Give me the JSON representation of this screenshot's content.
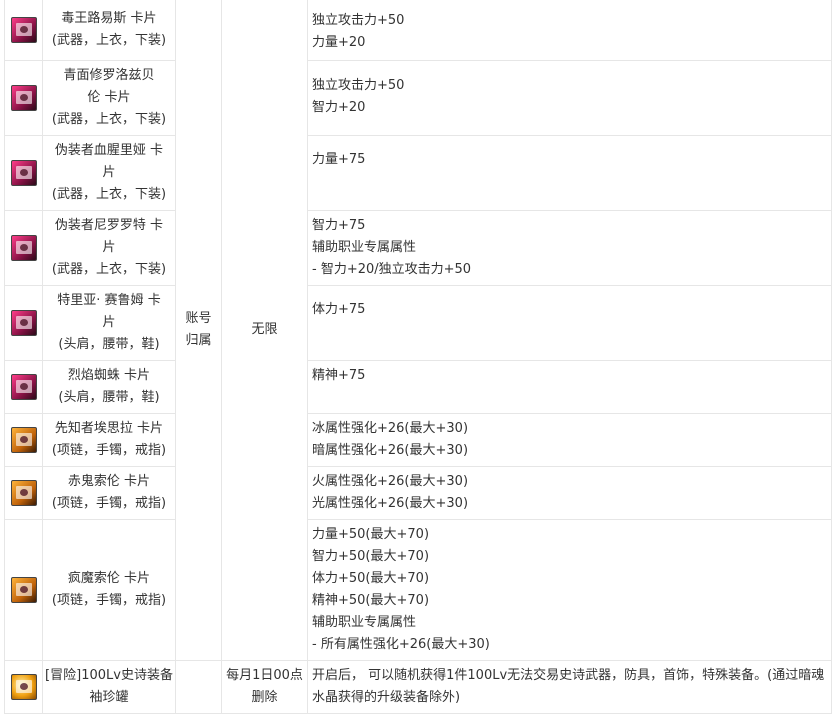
{
  "account_attr": [
    "账号",
    "归属"
  ],
  "limit_unlimited": "无限",
  "rows": [
    {
      "icon": "pink-card-icon",
      "name": [
        "毒王路易斯  卡片",
        "(武器，上衣，下装)"
      ],
      "effects": [
        "独立攻击力+50",
        "力量+20"
      ]
    },
    {
      "icon": "pink-card-icon",
      "name": [
        "青面修罗洛兹贝",
        "伦  卡片",
        "(武器，上衣，下装)"
      ],
      "effects": [
        "独立攻击力+50",
        "智力+20"
      ]
    },
    {
      "icon": "pink-card-icon",
      "name": [
        "伪装者血腥里娅  卡",
        "片",
        "(武器，上衣，下装)"
      ],
      "effects": [
        "力量+75"
      ]
    },
    {
      "icon": "pink-card-icon",
      "name": [
        "伪装者尼罗罗特  卡",
        "片",
        "(武器，上衣，下装)"
      ],
      "effects": [
        "智力+75",
        "辅助职业专属属性",
        "- 智力+20/独立攻击力+50"
      ]
    },
    {
      "icon": "pink-card-icon",
      "name": [
        "特里亚· 赛鲁姆  卡",
        "片",
        "(头肩，腰带，鞋)"
      ],
      "effects": [
        "体力+75"
      ]
    },
    {
      "icon": "pink-card-icon",
      "name": [
        "烈焰蜘蛛  卡片",
        "(头肩，腰带，鞋)"
      ],
      "effects": [
        "精神+75"
      ]
    },
    {
      "icon": "orange-card-icon",
      "name": [
        "先知者埃思拉  卡片",
        "(项链，手镯，戒指)"
      ],
      "effects": [
        "冰属性强化+26(最大+30)",
        "暗属性强化+26(最大+30)"
      ]
    },
    {
      "icon": "orange-card-icon",
      "name": [
        "赤鬼索伦  卡片",
        "(项链，手镯，戒指)"
      ],
      "effects": [
        "火属性强化+26(最大+30)",
        "光属性强化+26(最大+30)"
      ]
    },
    {
      "icon": "orange-card-icon",
      "name": [
        "疯魔索伦  卡片",
        "(项链，手镯，戒指)"
      ],
      "effects": [
        "力量+50(最大+70)",
        "智力+50(最大+70)",
        "体力+50(最大+70)",
        "精神+50(最大+70)",
        "辅助职业专属属性",
        "- 所有属性强化+26(最大+30)"
      ]
    }
  ],
  "last_row": {
    "icon": "epic-jar-icon",
    "name": [
      "[冒险]100Lv史诗装备",
      "袖珍罐"
    ],
    "limit": [
      "每月1日00点",
      "删除"
    ],
    "effects": [
      "开启后，  可以随机获得1件100Lv无法交易史诗武器，防具，首饰，特殊装备。(通过暗魂",
      "水晶获得的升级装备除外)"
    ]
  }
}
